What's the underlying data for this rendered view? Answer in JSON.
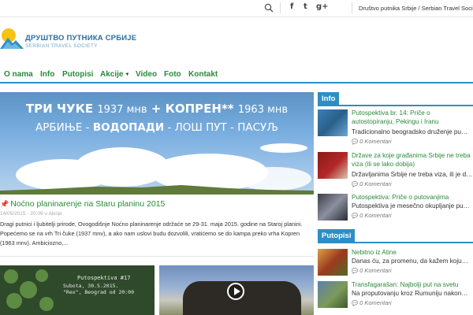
{
  "topbar": {
    "social": [
      "f",
      "t",
      "g+"
    ],
    "society_name": "Društvo putnika Srbije / Serbian Travel Society"
  },
  "logo": {
    "name": "ДРУШТВО ПУТНИКА СРБИЈЕ",
    "subtitle": "SERBIAN TRAVEL SOCIETY"
  },
  "nav": {
    "items": [
      "O nama",
      "Info",
      "Putopisi",
      "Akcije",
      "Video",
      "Foto",
      "Kontakt"
    ],
    "dropdown_caret": "▼"
  },
  "hero": {
    "line1_a": "ТРИ ЧУКЕ",
    "line1_b": "1937 мнв",
    "line1_plus": "+",
    "line1_c": "КОПРЕН**",
    "line1_d": "1963 мнв",
    "line2_a": "АРБИЊЕ -",
    "line2_b": "ВОДОПАДИ",
    "line2_c": "- ЛОШ ПУТ - ПАСУЉ"
  },
  "article": {
    "pin_icon": "pin-icon",
    "title": "Noćno planinarenje na Staru planinu 2015",
    "date": "14/05/2015 - 20:09 u",
    "category": "Akcije",
    "text": "Dragi putnici i ljubitelji prirode, Ovogodišnje Noćno planinarenje održaće se 29-31. maja 2015. godine na Staroj planini. Popećemo se na vrh Tri čuke (1937 mnv), a ako nam uslovi budu dozvolili, vratićemo se do kampa preko vrha Kopren (1963 mnv). Ambiciozno,..."
  },
  "thumbs": {
    "poster_title": "Putospektiva #17",
    "poster_date": "Subota, 30.5.2015.",
    "poster_place": "\"Rex\", Beograd od 20:00"
  },
  "sidebar": {
    "info_label": "Info",
    "putopisi_label": "Putopisi",
    "info_items": [
      {
        "title": "Putospektiva br. 14: Priče o autostopiranju, Pekingu i Iranu",
        "excerpt": "Tradicionalno beogradsko druženje pu…",
        "comments": "0 Komentari"
      },
      {
        "title": "Države za koje građanima Srbije ne treba viza (ili se lako dobija)",
        "excerpt": "Državljanima Srbije ne treba viza, ili je d…",
        "comments": "0 Komentari"
      },
      {
        "title": "Putospektiva: Priče o putovanjima",
        "excerpt": "Putospektiva je mesečno okupljanje pu…",
        "comments": "0 Komentari"
      }
    ],
    "putopisi_items": [
      {
        "title": "Nebitno iz Atine",
        "excerpt": "Danas ću, za promenu, da kažem koju…",
        "comments": "0 Komentari"
      },
      {
        "title": "Transfagarašan: Najbolji put na svetu",
        "excerpt": "Na proputovanju kroz Rumuniju nakon…",
        "comments": "0 Komentari"
      }
    ]
  },
  "colors": {
    "accent_blue": "#2d8ec6",
    "link_green": "#2a8a3a"
  }
}
